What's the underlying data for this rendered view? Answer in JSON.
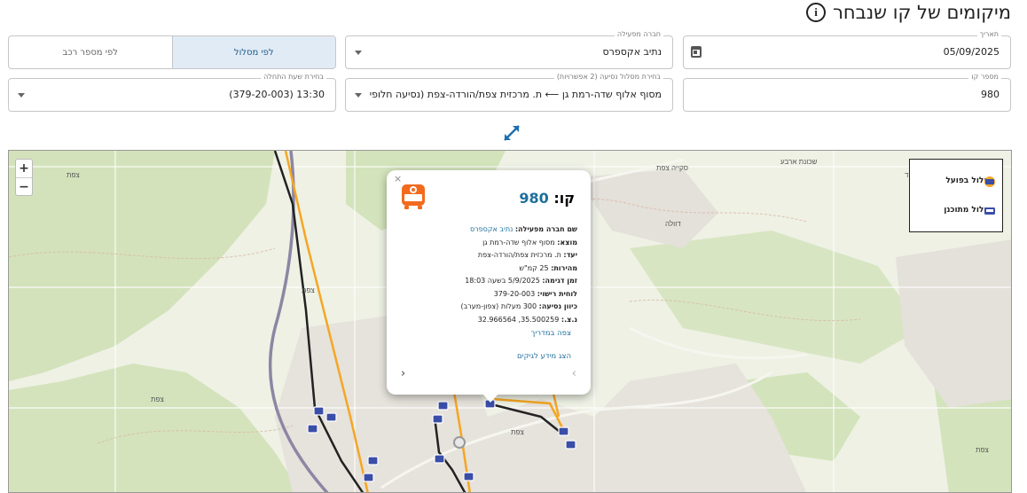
{
  "page": {
    "title": "מיקומים של קו שנבחר"
  },
  "filters": {
    "date": {
      "label": "תאריך",
      "value": "05/09/2025"
    },
    "operator": {
      "label": "חברה מפעילה",
      "value": "נתיב אקספרס"
    },
    "toggle": {
      "route_label": "לפי מסלול",
      "vehicle_label": "לפי מספר רכב"
    },
    "line": {
      "label": "מספר קו",
      "value": "980"
    },
    "route": {
      "label": "בחירת מסלול נסיעה (2 אפשרויות)",
      "value": "מסוף אלוף שדה-רמת גן ⟵ ת. מרכזית צפת/הורדה-צפת  (נסיעה חלופית ..."
    },
    "start_time": {
      "label": "בחירת שעת התחלה",
      "value": "13:30 (379-20-003)"
    }
  },
  "map": {
    "zoom_in": "+",
    "zoom_out": "−",
    "legend": {
      "actual": "מסלול בפועל",
      "planned": "מסלול מתוכנן"
    },
    "place_labels": [
      "צפת",
      "צפת",
      "צפת",
      "דוולה",
      "סקייה צפת",
      "שכונת ארבע",
      "צפת",
      "הגדוד",
      "צפת"
    ]
  },
  "popup": {
    "close": "×",
    "line_label": "קו:",
    "line_number": "980",
    "operator_label": "שם חברה מפעילה:",
    "operator_value": "נתיב אקספרס",
    "origin_label": "מוצא:",
    "origin_value": "מסוף אלוף שדה-רמת גן",
    "dest_label": "יעד:",
    "dest_value": "ת. מרכזית צפת/הורדה-צפת",
    "speed_label": "מהירות:",
    "speed_value": "25 קמ\"ש",
    "sample_label": "זמן דגימה:",
    "sample_value": "5/9/2025 בשעה 18:03",
    "plate_label": "לוחית רישוי:",
    "plate_value": "379-20-003",
    "heading_label": "כיוון נסיעה:",
    "heading_value": "300 מעלות (צפון-מערב)",
    "coords_label": "נ.צ.:",
    "coords_value": "35.500259, 32.966564",
    "view_guide": "צפה במדריך",
    "show_logs": "הצג מידע לגיקים",
    "nav_prev": "‹",
    "nav_next": "›"
  },
  "colors": {
    "accent": "#1f6f9c",
    "actual_route": "#f5a623",
    "planned_route": "#222222",
    "bus_icon": "#f26b1d",
    "stop_icon": "#3a4ea8"
  }
}
